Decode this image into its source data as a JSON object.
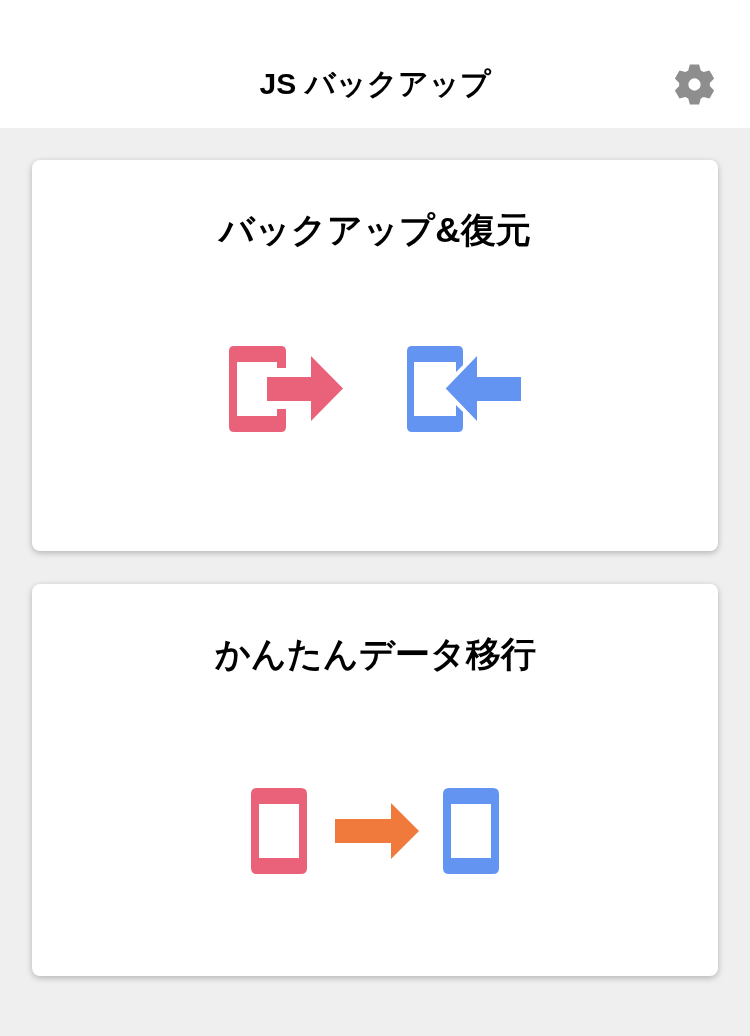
{
  "header": {
    "title": "JS バックアップ"
  },
  "cards": [
    {
      "kind": "backup_restore",
      "title": "バックアップ&復元"
    },
    {
      "kind": "transfer",
      "title": "かんたんデータ移行"
    }
  ]
}
